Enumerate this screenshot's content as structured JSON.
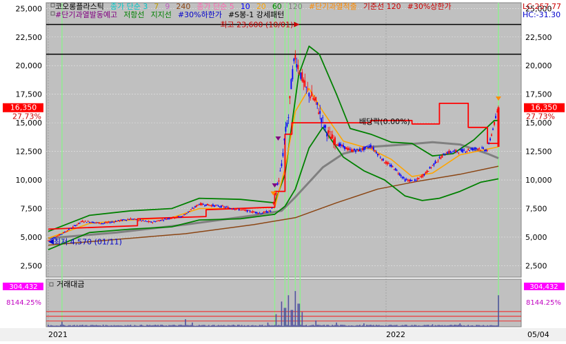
{
  "legend": {
    "row1": [
      {
        "text": "코오롱플라스틱",
        "color": "#000000"
      },
      {
        "text": "종가 단순 3",
        "color": "#00c8c8"
      },
      {
        "text": "7",
        "color": "#c0a000"
      },
      {
        "text": "9",
        "color": "#c060c0"
      },
      {
        "text": "240",
        "color": "#8b4513"
      },
      {
        "text": "종가 단순 5",
        "color": "#ff69b4"
      },
      {
        "text": "10",
        "color": "#0000ff"
      },
      {
        "text": "20",
        "color": "#ffa500"
      },
      {
        "text": "60",
        "color": "#008000"
      },
      {
        "text": "120",
        "color": "#808080"
      },
      {
        "text": "#단기과열적출",
        "color": "#ff8c00"
      },
      {
        "text": "기준선 120",
        "color": "#cc0000"
      },
      {
        "text": "#30%상한가",
        "color": "#cc0000"
      }
    ],
    "row2": [
      {
        "text": "#단기과열발동예고",
        "color": "#800080"
      },
      {
        "text": "저항선",
        "color": "#008000"
      },
      {
        "text": "지지선",
        "color": "#008000"
      },
      {
        "text": "#30%하한가",
        "color": "#0000cc"
      },
      {
        "text": "#S봉-1 강세패턴",
        "color": "#000000"
      }
    ]
  },
  "corner": {
    "lc": "LC:257.77",
    "hc": "HC:-31.30"
  },
  "badges": {
    "price": "16,350",
    "price_pct": "27.73%",
    "volume": "304,432",
    "volume_pct": "8144.25%"
  },
  "annotations": {
    "high": "최고 23,600 (10/01)",
    "low": "최저 4,570 (01/11)",
    "dividend": "배당락(0.00%)"
  },
  "volume_label": "거래대금",
  "colors": {
    "panel_bg": "#c0c0c0",
    "up": "#ff0000",
    "down": "#0000ff",
    "ma5": "#ff69b4",
    "ma10": "#0000ff",
    "ma20": "#ffa500",
    "ma60": "#008000",
    "ma120": "#808080",
    "ma240": "#8b4513",
    "bollinger": "#008000",
    "baseline": "#ff0000",
    "signal": "#90ee90",
    "badge": "#ff0000",
    "vol_badge": "#ff00ff"
  },
  "chart_data": {
    "type": "candlestick",
    "yticks": [
      "25,000",
      "22,500",
      "20,000",
      "17,500",
      "15,000",
      "12,500",
      "10,000",
      "7,500",
      "5,000",
      "2,500"
    ],
    "ytick_values": [
      25000,
      22500,
      20000,
      17500,
      15000,
      12500,
      10000,
      7500,
      5000,
      2500
    ],
    "ylim": [
      1500,
      25500
    ],
    "xlabels": [
      "2021",
      "2022",
      "05/04"
    ],
    "horizontal_lines": [
      23600,
      21000
    ],
    "series": [
      {
        "name": "price",
        "points": [
          [
            0,
            4700
          ],
          [
            20,
            5300
          ],
          [
            50,
            6400
          ],
          [
            80,
            6200
          ],
          [
            120,
            6600
          ],
          [
            150,
            6300
          ],
          [
            180,
            6700
          ],
          [
            195,
            6800
          ],
          [
            220,
            7900
          ],
          [
            250,
            7700
          ],
          [
            280,
            7400
          ],
          [
            310,
            7100
          ],
          [
            325,
            7300
          ],
          [
            330,
            8400
          ],
          [
            340,
            11200
          ],
          [
            345,
            14000
          ],
          [
            350,
            15500
          ],
          [
            355,
            19000
          ],
          [
            360,
            20800
          ],
          [
            365,
            19800
          ],
          [
            375,
            18000
          ],
          [
            390,
            16800
          ],
          [
            405,
            14300
          ],
          [
            420,
            13200
          ],
          [
            440,
            12600
          ],
          [
            455,
            12600
          ],
          [
            470,
            13000
          ],
          [
            490,
            11600
          ],
          [
            505,
            11000
          ],
          [
            520,
            10000
          ],
          [
            535,
            9900
          ],
          [
            550,
            10600
          ],
          [
            565,
            11600
          ],
          [
            580,
            12400
          ],
          [
            595,
            12500
          ],
          [
            610,
            12600
          ],
          [
            625,
            12800
          ],
          [
            640,
            12600
          ],
          [
            656,
            16350
          ]
        ]
      },
      {
        "name": "ma20",
        "points": [
          [
            0,
            4900
          ],
          [
            60,
            6200
          ],
          [
            120,
            6500
          ],
          [
            180,
            6700
          ],
          [
            220,
            7500
          ],
          [
            280,
            7500
          ],
          [
            330,
            7600
          ],
          [
            345,
            11000
          ],
          [
            360,
            16000
          ],
          [
            380,
            18000
          ],
          [
            400,
            16000
          ],
          [
            430,
            13400
          ],
          [
            470,
            12700
          ],
          [
            500,
            11800
          ],
          [
            530,
            10300
          ],
          [
            560,
            10600
          ],
          [
            600,
            12200
          ],
          [
            640,
            12700
          ],
          [
            656,
            12900
          ]
        ]
      },
      {
        "name": "ma120",
        "points": [
          [
            0,
            4900
          ],
          [
            100,
            5400
          ],
          [
            200,
            6100
          ],
          [
            300,
            6900
          ],
          [
            340,
            7300
          ],
          [
            360,
            8500
          ],
          [
            400,
            11100
          ],
          [
            430,
            12300
          ],
          [
            470,
            12900
          ],
          [
            520,
            13100
          ],
          [
            560,
            13300
          ],
          [
            600,
            13100
          ],
          [
            640,
            12300
          ],
          [
            656,
            11900
          ]
        ]
      },
      {
        "name": "ma240",
        "points": [
          [
            0,
            4300
          ],
          [
            100,
            4800
          ],
          [
            200,
            5300
          ],
          [
            300,
            6100
          ],
          [
            360,
            6700
          ],
          [
            420,
            8000
          ],
          [
            480,
            9200
          ],
          [
            540,
            9900
          ],
          [
            600,
            10500
          ],
          [
            656,
            11200
          ]
        ]
      },
      {
        "name": "bollinger_upper",
        "points": [
          [
            0,
            5500
          ],
          [
            60,
            6900
          ],
          [
            120,
            7300
          ],
          [
            180,
            7500
          ],
          [
            220,
            8400
          ],
          [
            280,
            8300
          ],
          [
            330,
            8000
          ],
          [
            345,
            10500
          ],
          [
            365,
            19200
          ],
          [
            380,
            21700
          ],
          [
            395,
            21000
          ],
          [
            420,
            17500
          ],
          [
            440,
            14500
          ],
          [
            470,
            14000
          ],
          [
            500,
            13300
          ],
          [
            530,
            13200
          ],
          [
            560,
            12100
          ],
          [
            590,
            12300
          ],
          [
            620,
            13500
          ],
          [
            650,
            15200
          ],
          [
            656,
            15200
          ]
        ]
      },
      {
        "name": "bollinger_lower",
        "points": [
          [
            0,
            3900
          ],
          [
            60,
            5400
          ],
          [
            120,
            5700
          ],
          [
            180,
            5900
          ],
          [
            220,
            6500
          ],
          [
            280,
            6600
          ],
          [
            330,
            7000
          ],
          [
            345,
            7700
          ],
          [
            360,
            9200
          ],
          [
            380,
            12800
          ],
          [
            400,
            14600
          ],
          [
            430,
            12000
          ],
          [
            460,
            10800
          ],
          [
            490,
            10000
          ],
          [
            520,
            8600
          ],
          [
            545,
            8200
          ],
          [
            570,
            8400
          ],
          [
            600,
            9000
          ],
          [
            630,
            9800
          ],
          [
            656,
            10100
          ]
        ]
      },
      {
        "name": "baseline",
        "points": [
          [
            0,
            5700
          ],
          [
            130,
            6000
          ],
          [
            130,
            6600
          ],
          [
            230,
            6800
          ],
          [
            230,
            7400
          ],
          [
            320,
            7600
          ],
          [
            330,
            7600
          ],
          [
            330,
            9000
          ],
          [
            345,
            9000
          ],
          [
            345,
            14000
          ],
          [
            355,
            14000
          ],
          [
            355,
            15000
          ],
          [
            400,
            15000
          ],
          [
            470,
            15000
          ],
          [
            470,
            15200
          ],
          [
            530,
            15200
          ],
          [
            530,
            14900
          ],
          [
            570,
            14900
          ],
          [
            570,
            16700
          ],
          [
            612,
            16700
          ],
          [
            612,
            14600
          ],
          [
            640,
            14600
          ],
          [
            640,
            13200
          ],
          [
            656,
            13200
          ]
        ]
      }
    ],
    "volume": {
      "label": "거래대금",
      "spikes": [
        [
          0,
          0.05
        ],
        [
          20,
          0.12
        ],
        [
          80,
          0.05
        ],
        [
          200,
          0.18
        ],
        [
          210,
          0.1
        ],
        [
          320,
          0.1
        ],
        [
          332,
          0.3
        ],
        [
          340,
          0.6
        ],
        [
          345,
          0.45
        ],
        [
          350,
          0.75
        ],
        [
          355,
          0.4
        ],
        [
          360,
          0.85
        ],
        [
          365,
          0.55
        ],
        [
          370,
          0.35
        ],
        [
          390,
          0.15
        ],
        [
          420,
          0.1
        ],
        [
          460,
          0.08
        ],
        [
          520,
          0.05
        ],
        [
          560,
          0.06
        ],
        [
          600,
          0.08
        ],
        [
          656,
          0.75
        ]
      ]
    },
    "signal_lines": [
      20,
      330,
      345,
      350,
      360,
      367,
      656
    ]
  }
}
